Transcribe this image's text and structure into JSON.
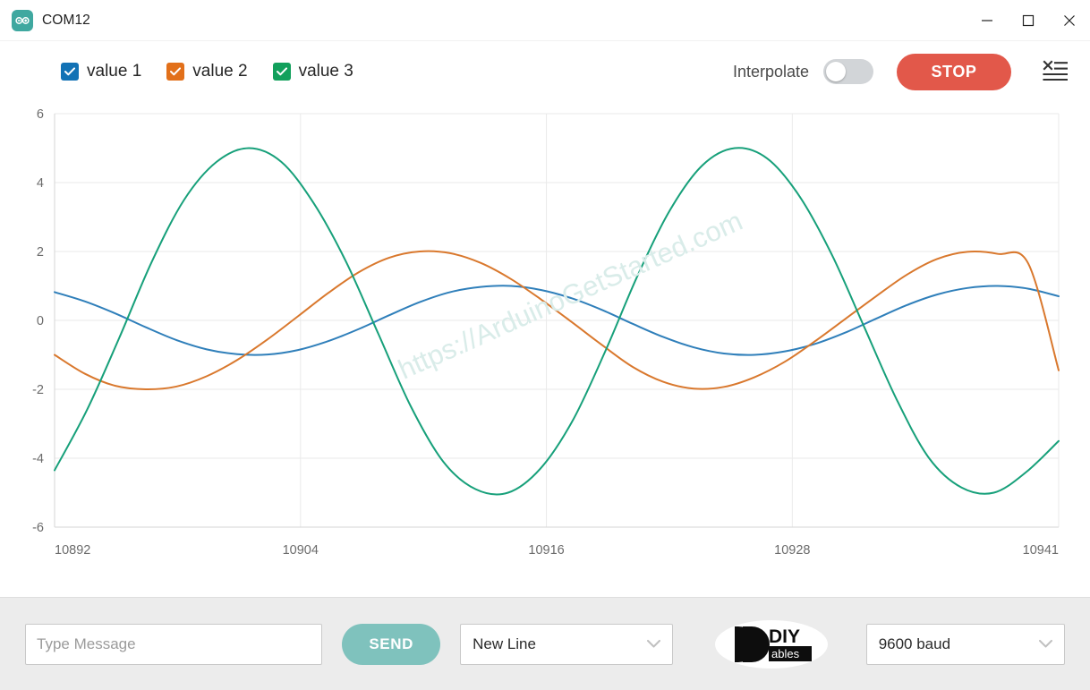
{
  "window": {
    "title": "COM12",
    "app_icon": "arduino-infinity-icon",
    "minimize_label": "Minimize",
    "maximize_label": "Maximize",
    "close_label": "Close"
  },
  "toolbar": {
    "series_toggles": [
      {
        "label": "value 1",
        "checked": true,
        "color": "#1272b5"
      },
      {
        "label": "value 2",
        "checked": true,
        "color": "#e2701a"
      },
      {
        "label": "value 3",
        "checked": true,
        "color": "#12a05c"
      }
    ],
    "interpolate_label": "Interpolate",
    "interpolate_on": false,
    "stop_label": "STOP",
    "stop_color": "#e2584a",
    "clear_icon": "clear-output-icon"
  },
  "chart_data": {
    "type": "line",
    "title": "",
    "xlabel": "",
    "ylabel": "",
    "xlim": [
      10892,
      10941
    ],
    "ylim": [
      -6,
      6
    ],
    "x_ticks": [
      "10892",
      "10904",
      "10916",
      "10928",
      "10941"
    ],
    "x_tick_values": [
      10892,
      10904,
      10916,
      10928,
      10941
    ],
    "y_ticks": [
      "6",
      "4",
      "2",
      "0",
      "-2",
      "-4",
      "-6"
    ],
    "y_tick_values": [
      6,
      4,
      2,
      0,
      -2,
      -4,
      -6
    ],
    "grid": true,
    "legend_position": "top-left",
    "interpolated": false,
    "series": [
      {
        "name": "value 1",
        "color": "#2f7fba",
        "amplitude": 1,
        "phase_deg": 55,
        "period_samples": 24.5,
        "values": [
          0.82,
          0.55,
          0.2,
          -0.2,
          -0.57,
          -0.84,
          -0.98,
          -0.99,
          -0.86,
          -0.6,
          -0.25,
          0.15,
          0.53,
          0.82,
          0.97,
          1.0,
          0.88,
          0.64,
          0.3,
          -0.1,
          -0.48,
          -0.78,
          -0.96,
          -1.0,
          -0.9,
          -0.68,
          -0.35,
          0.05,
          0.44,
          0.75,
          0.94,
          1.0,
          0.92,
          0.7
        ]
      },
      {
        "name": "value 2",
        "color": "#d9782d",
        "amplitude": 2,
        "phase_deg": 210,
        "period_samples": 24.5,
        "values": [
          -1.0,
          -1.55,
          -1.9,
          -2.0,
          -1.92,
          -1.62,
          -1.15,
          -0.55,
          0.12,
          0.8,
          1.4,
          1.82,
          2.0,
          1.95,
          1.67,
          1.2,
          0.6,
          -0.05,
          -0.72,
          -1.35,
          -1.78,
          -1.98,
          -1.93,
          -1.65,
          -1.2,
          -0.6,
          0.05,
          0.7,
          1.32,
          1.78,
          1.99,
          1.93,
          1.65,
          -1.45
        ]
      },
      {
        "name": "value 3",
        "color": "#17a07a",
        "amplitude": 5,
        "phase_deg": 300,
        "period_samples": 24.5,
        "values": [
          -4.35,
          -2.6,
          -0.5,
          1.7,
          3.5,
          4.6,
          5.0,
          4.6,
          3.4,
          1.7,
          -0.4,
          -2.5,
          -4.1,
          -4.9,
          -5.0,
          -4.3,
          -2.9,
          -0.9,
          1.3,
          3.2,
          4.5,
          5.0,
          4.7,
          3.6,
          1.9,
          -0.2,
          -2.3,
          -4.0,
          -4.85,
          -5.0,
          -4.4,
          -3.5
        ]
      }
    ],
    "watermark": "https://ArduinoGetStarted.com"
  },
  "bottombar": {
    "message_value": "",
    "message_placeholder": "Type Message",
    "send_label": "SEND",
    "line_ending": "New Line",
    "baud_rate": "9600 baud",
    "brand_logo": "diyables-logo",
    "brand_main": "DIY",
    "brand_sub": "ables"
  }
}
